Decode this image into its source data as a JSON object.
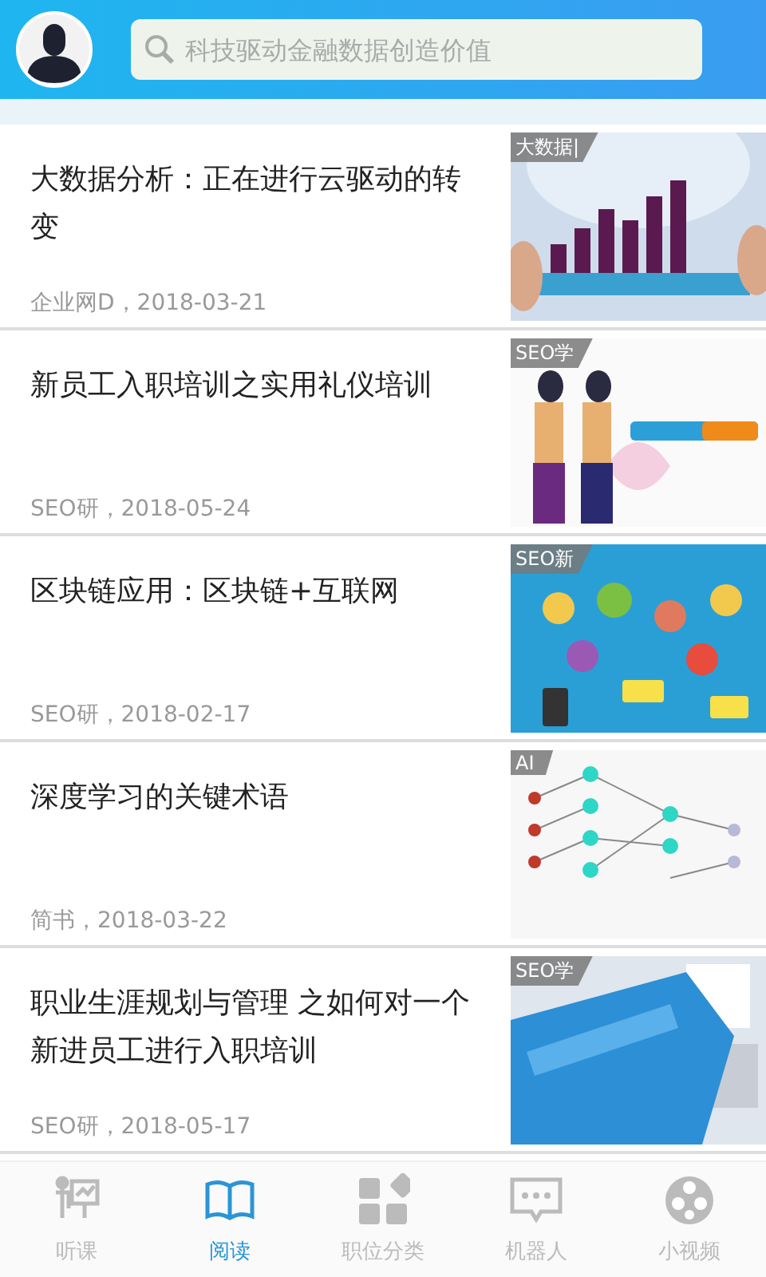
{
  "header": {
    "search": {
      "placeholder": "科技驱动金融数据创造价值"
    }
  },
  "articles": [
    {
      "title": "大数据分析：正在进行云驱动的转变",
      "meta": "企业网D，2018-03-21",
      "tag": "大数据|"
    },
    {
      "title": "新员工入职培训之实用礼仪培训",
      "meta": "SEO研，2018-05-24",
      "tag": "SEO学"
    },
    {
      "title": "区块链应用：区块链+互联网",
      "meta": "SEO研，2018-02-17",
      "tag": "SEO新"
    },
    {
      "title": "深度学习的关键术语",
      "meta": "简书，2018-03-22",
      "tag": "AI"
    },
    {
      "title": "职业生涯规划与管理 之如何对一个新进员工进行入职培训",
      "meta": "SEO研，2018-05-17",
      "tag": "SEO学"
    }
  ],
  "tabbar": [
    {
      "label": "听课",
      "kind": "lecture",
      "selected": false
    },
    {
      "label": "阅读",
      "kind": "book",
      "selected": true
    },
    {
      "label": "职位分类",
      "kind": "grid",
      "selected": false
    },
    {
      "label": "机器人",
      "kind": "chat",
      "selected": false
    },
    {
      "label": "小视频",
      "kind": "film",
      "selected": false
    }
  ]
}
